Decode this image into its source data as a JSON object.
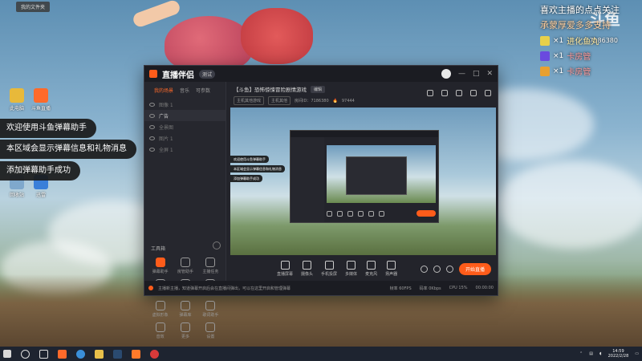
{
  "desktop": {
    "top_tag": "我的文件夹",
    "icons": [
      {
        "label": "此电脑",
        "color": "#e8b93a"
      },
      {
        "label": "斗鱼直播",
        "color": "#ff6a2a"
      },
      {
        "label": "回收站",
        "color": "#7fa8cc"
      },
      {
        "label": "迅雷",
        "color": "#3a7fd9"
      }
    ]
  },
  "toasts": [
    "欢迎使用斗鱼弹幕助手",
    "本区域会显示弹幕信息和礼物消息",
    "添加弹幕助手成功"
  ],
  "overlay": {
    "line1": "喜欢主播的点点关注",
    "line2": "承蒙厚爱多多支持",
    "watermark": "斗鱼",
    "room_id": "7186380",
    "gifts": [
      {
        "count": "×1",
        "name": "进化鱼丸",
        "color": "#e8d04a"
      },
      {
        "count": "×1",
        "name": "卡房管",
        "color": "#6a4adf"
      },
      {
        "count": "×1",
        "name": "卡房管",
        "color": "#e8a030"
      }
    ]
  },
  "app": {
    "brand": "直播伴侣",
    "version": "测试",
    "window_controls": [
      "—",
      "□",
      "✕"
    ],
    "side_tabs": [
      "我的场景",
      "音乐",
      "可参数"
    ],
    "scenes": [
      "图像 1",
      "广告",
      "全景图",
      "图片 1",
      "全屏 1"
    ],
    "tools_title": "工具箱",
    "tools": [
      "弹幕助手",
      "房管助手",
      "主播任务",
      "预约直播",
      "多人连麦",
      "投屏器",
      "虚拟形象",
      "弹幕库",
      "歌词助手",
      "音效",
      "更多",
      "设置"
    ],
    "room": {
      "title": "【斗鱼】恐怖惊悚冒险剧情游戏",
      "edit": "编辑",
      "category": "主机其他游戏",
      "subcategory": "主机其他",
      "room_no": "房间ID：7186380",
      "viewers": "97444"
    },
    "preview_toasts": [
      "欢迎使用斗鱼弹幕助手",
      "本区域会显示弹幕信息和礼物消息",
      "添加弹幕助手成功"
    ],
    "controls": [
      "直播屏幕",
      "摄像头",
      "手机投屏",
      "多媒体",
      "麦克风",
      "扬声器"
    ],
    "start_button": "开始直播",
    "status_text": "主播新主播，知道弹幕开启后会在直播间弹出，可以在这里开启和管理弹幕",
    "status_right": [
      "帧率 60FPS",
      "码率 0Kbps",
      "CPU 15%",
      "00:00:00"
    ]
  },
  "taskbar": {
    "time": "14:59",
    "date": "2022/2/28"
  }
}
